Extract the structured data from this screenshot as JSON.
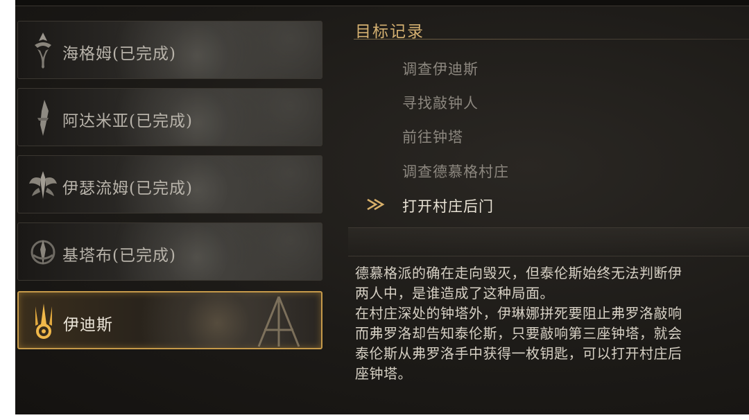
{
  "chapters": [
    {
      "label": "海格姆(已完成)",
      "icon": "haigm-emblem-icon",
      "active": false
    },
    {
      "label": "阿达米亚(已完成)",
      "icon": "dagger-emblem-icon",
      "active": false
    },
    {
      "label": "伊瑟流姆(已完成)",
      "icon": "winged-emblem-icon",
      "active": false
    },
    {
      "label": "基塔布(已完成)",
      "icon": "crest-emblem-icon",
      "active": false
    },
    {
      "label": "伊迪斯",
      "icon": "flame-emblem-icon",
      "active": true
    }
  ],
  "objectives_panel": {
    "title": "目标记录",
    "items": [
      {
        "text": "调查伊迪斯",
        "current": false
      },
      {
        "text": "寻找敲钟人",
        "current": false
      },
      {
        "text": "前往钟塔",
        "current": false
      },
      {
        "text": "调查德慕格村庄",
        "current": false
      },
      {
        "text": "打开村庄后门",
        "current": true
      }
    ],
    "current_marker_icon": "double-chevron-icon"
  },
  "story": {
    "lines": [
      "德慕格派的确在走向毁灭，但泰伦斯始终无法判断伊",
      "两人中，是谁造成了这种局面。",
      "在村庄深处的钟塔外，伊琳娜拼死要阻止弗罗洛敲响",
      "而弗罗洛却告知泰伦斯，只要敲响第三座钟塔，就会",
      "泰伦斯从弗罗洛手中获得一枚钥匙，可以打开村庄后",
      "座钟塔。"
    ]
  },
  "colors": {
    "accent_gold": "#c69a4a",
    "title_gold": "#d4b071",
    "text_dim": "#8c877f",
    "text_bright": "#e9e3d6"
  }
}
